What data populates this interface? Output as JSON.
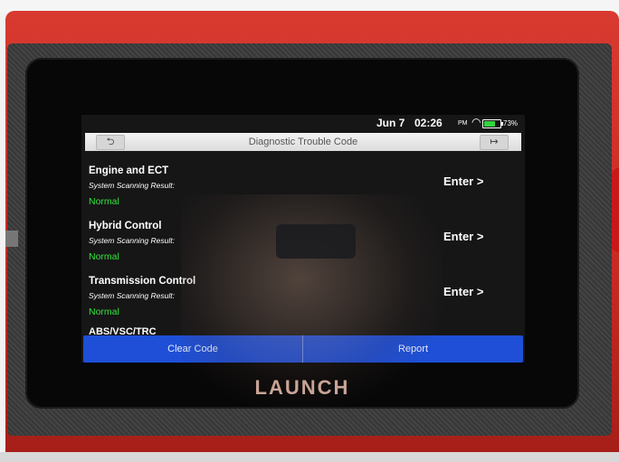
{
  "status_bar": {
    "date": "Jun 7",
    "time": "02:26",
    "ampm": "PM",
    "wifi_icon": "wifi-icon",
    "battery_level": 0.73,
    "battery_text": "73%",
    "battery_color": "#33d63d"
  },
  "header": {
    "title": "Diagnostic Trouble Code",
    "back_icon": "back-arrow-icon",
    "exit_icon": "exit-icon"
  },
  "systems": [
    {
      "name": "Engine and ECT",
      "subtitle": "System Scanning Result:",
      "status": "Normal",
      "action": "Enter >"
    },
    {
      "name": "Hybrid Control",
      "subtitle": "System Scanning Result:",
      "status": "Normal",
      "action": "Enter >"
    },
    {
      "name": "Transmission Control",
      "subtitle": "System Scanning Result:",
      "status": "Normal",
      "action": "Enter >"
    }
  ],
  "clipped_item": "ABS/VSC/TRC",
  "actions": {
    "clear_code": "Clear Code",
    "report": "Report"
  },
  "device": {
    "brand": "LAUNCH",
    "accent_color": "#c52a22",
    "action_bar_color": "#1e4fd6",
    "status_ok_color": "#33e43f"
  }
}
